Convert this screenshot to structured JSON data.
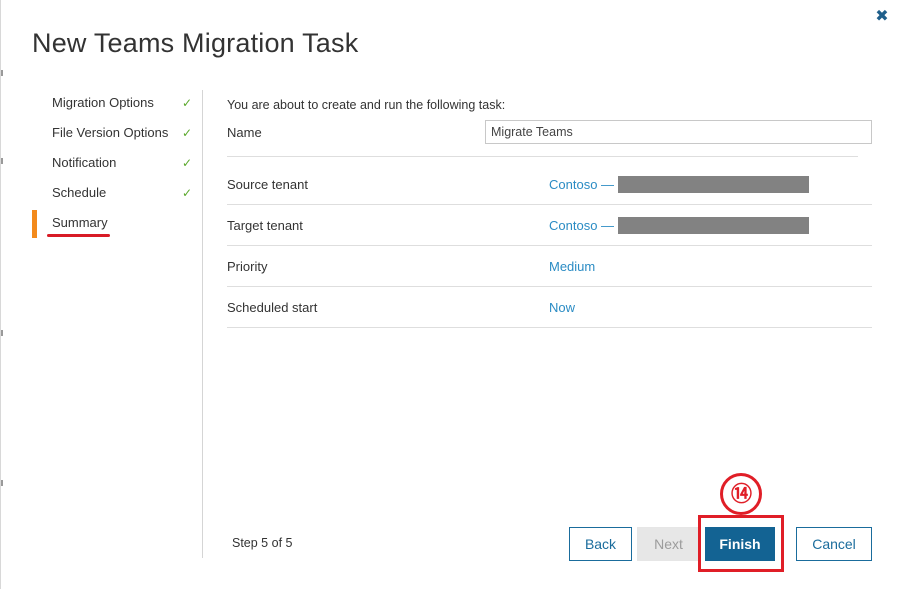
{
  "dialog": {
    "title": "New Teams Migration Task",
    "close_icon": "close-icon"
  },
  "sidebar": {
    "items": [
      {
        "label": "Migration Options",
        "completed": true
      },
      {
        "label": "File Version Options",
        "completed": true
      },
      {
        "label": "Notification",
        "completed": true
      },
      {
        "label": "Schedule",
        "completed": true
      },
      {
        "label": "Summary",
        "completed": false,
        "active": true
      }
    ],
    "check_glyph": "✓",
    "active_color": "#f38a1c"
  },
  "summary": {
    "intro": "You are about to create and run the following task:",
    "name_label": "Name",
    "name_value": "Migrate Teams",
    "rows": [
      {
        "label": "Source tenant",
        "value": "Contoso —",
        "redacted": true
      },
      {
        "label": "Target tenant",
        "value": "Contoso —",
        "redacted": true
      },
      {
        "label": "Priority",
        "value": "Medium"
      },
      {
        "label": "Scheduled start",
        "value": "Now"
      }
    ]
  },
  "footer": {
    "step_text": "Step 5 of 5",
    "back_label": "Back",
    "next_label": "Next",
    "finish_label": "Finish",
    "cancel_label": "Cancel"
  },
  "annotation": {
    "step_number": "⑭",
    "color": "#e01e27"
  },
  "colors": {
    "link": "#2b8cc4",
    "primary": "#136393",
    "check": "#5aa82c"
  }
}
